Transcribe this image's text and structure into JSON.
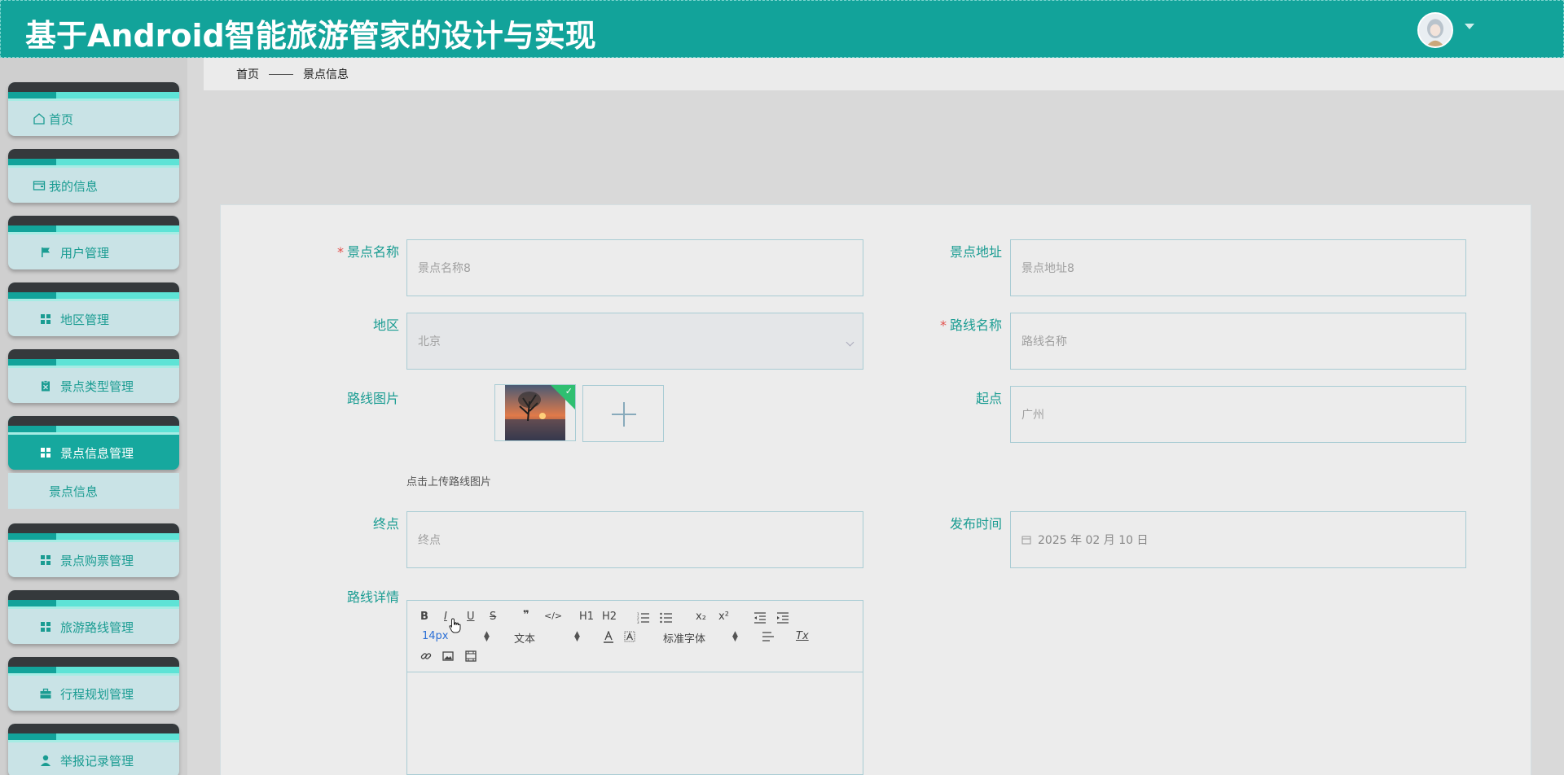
{
  "header": {
    "title": "基于Android智能旅游管家的设计与实现"
  },
  "sidebar": {
    "items": [
      {
        "label": "首页",
        "icon": "home-icon"
      },
      {
        "label": "我的信息",
        "icon": "wallet-icon"
      },
      {
        "label": "用户管理",
        "icon": "flag-icon"
      },
      {
        "label": "地区管理",
        "icon": "grid-icon"
      },
      {
        "label": "景点类型管理",
        "icon": "clipboard-icon"
      },
      {
        "label": "景点信息管理",
        "icon": "grid-icon"
      },
      {
        "label": "景点购票管理",
        "icon": "grid-icon"
      },
      {
        "label": "旅游路线管理",
        "icon": "grid-icon"
      },
      {
        "label": "行程规划管理",
        "icon": "briefcase-icon"
      },
      {
        "label": "举报记录管理",
        "icon": "user-icon"
      }
    ],
    "submenu": {
      "label": "景点信息"
    }
  },
  "breadcrumb": {
    "home": "首页",
    "current": "景点信息"
  },
  "form": {
    "spot_name": {
      "label": "景点名称",
      "value": "景点名称8"
    },
    "spot_address": {
      "label": "景点地址",
      "value": "景点地址8"
    },
    "region": {
      "label": "地区",
      "value": "北京"
    },
    "route_name": {
      "label": "路线名称",
      "placeholder": "路线名称"
    },
    "route_image": {
      "label": "路线图片",
      "tip": "点击上传路线图片"
    },
    "start": {
      "label": "起点",
      "value": "广州"
    },
    "end": {
      "label": "终点",
      "placeholder": "终点"
    },
    "publish_time": {
      "label": "发布时间",
      "value": "2025 年 02 月 10 日"
    },
    "route_detail": {
      "label": "路线详情"
    }
  },
  "editor": {
    "bold": "B",
    "italic": "I",
    "underline": "U",
    "strike": "S",
    "quote": "❞",
    "code": "</>",
    "h1": "H1",
    "h2": "H2",
    "sub": "x₂",
    "sup": "x²",
    "size": "14px",
    "text_type": "文本",
    "font": "标准字体",
    "clear": "Tx"
  },
  "colors": {
    "primary": "#12a39a",
    "label": "#1a9c92",
    "required": "#e2504c"
  }
}
